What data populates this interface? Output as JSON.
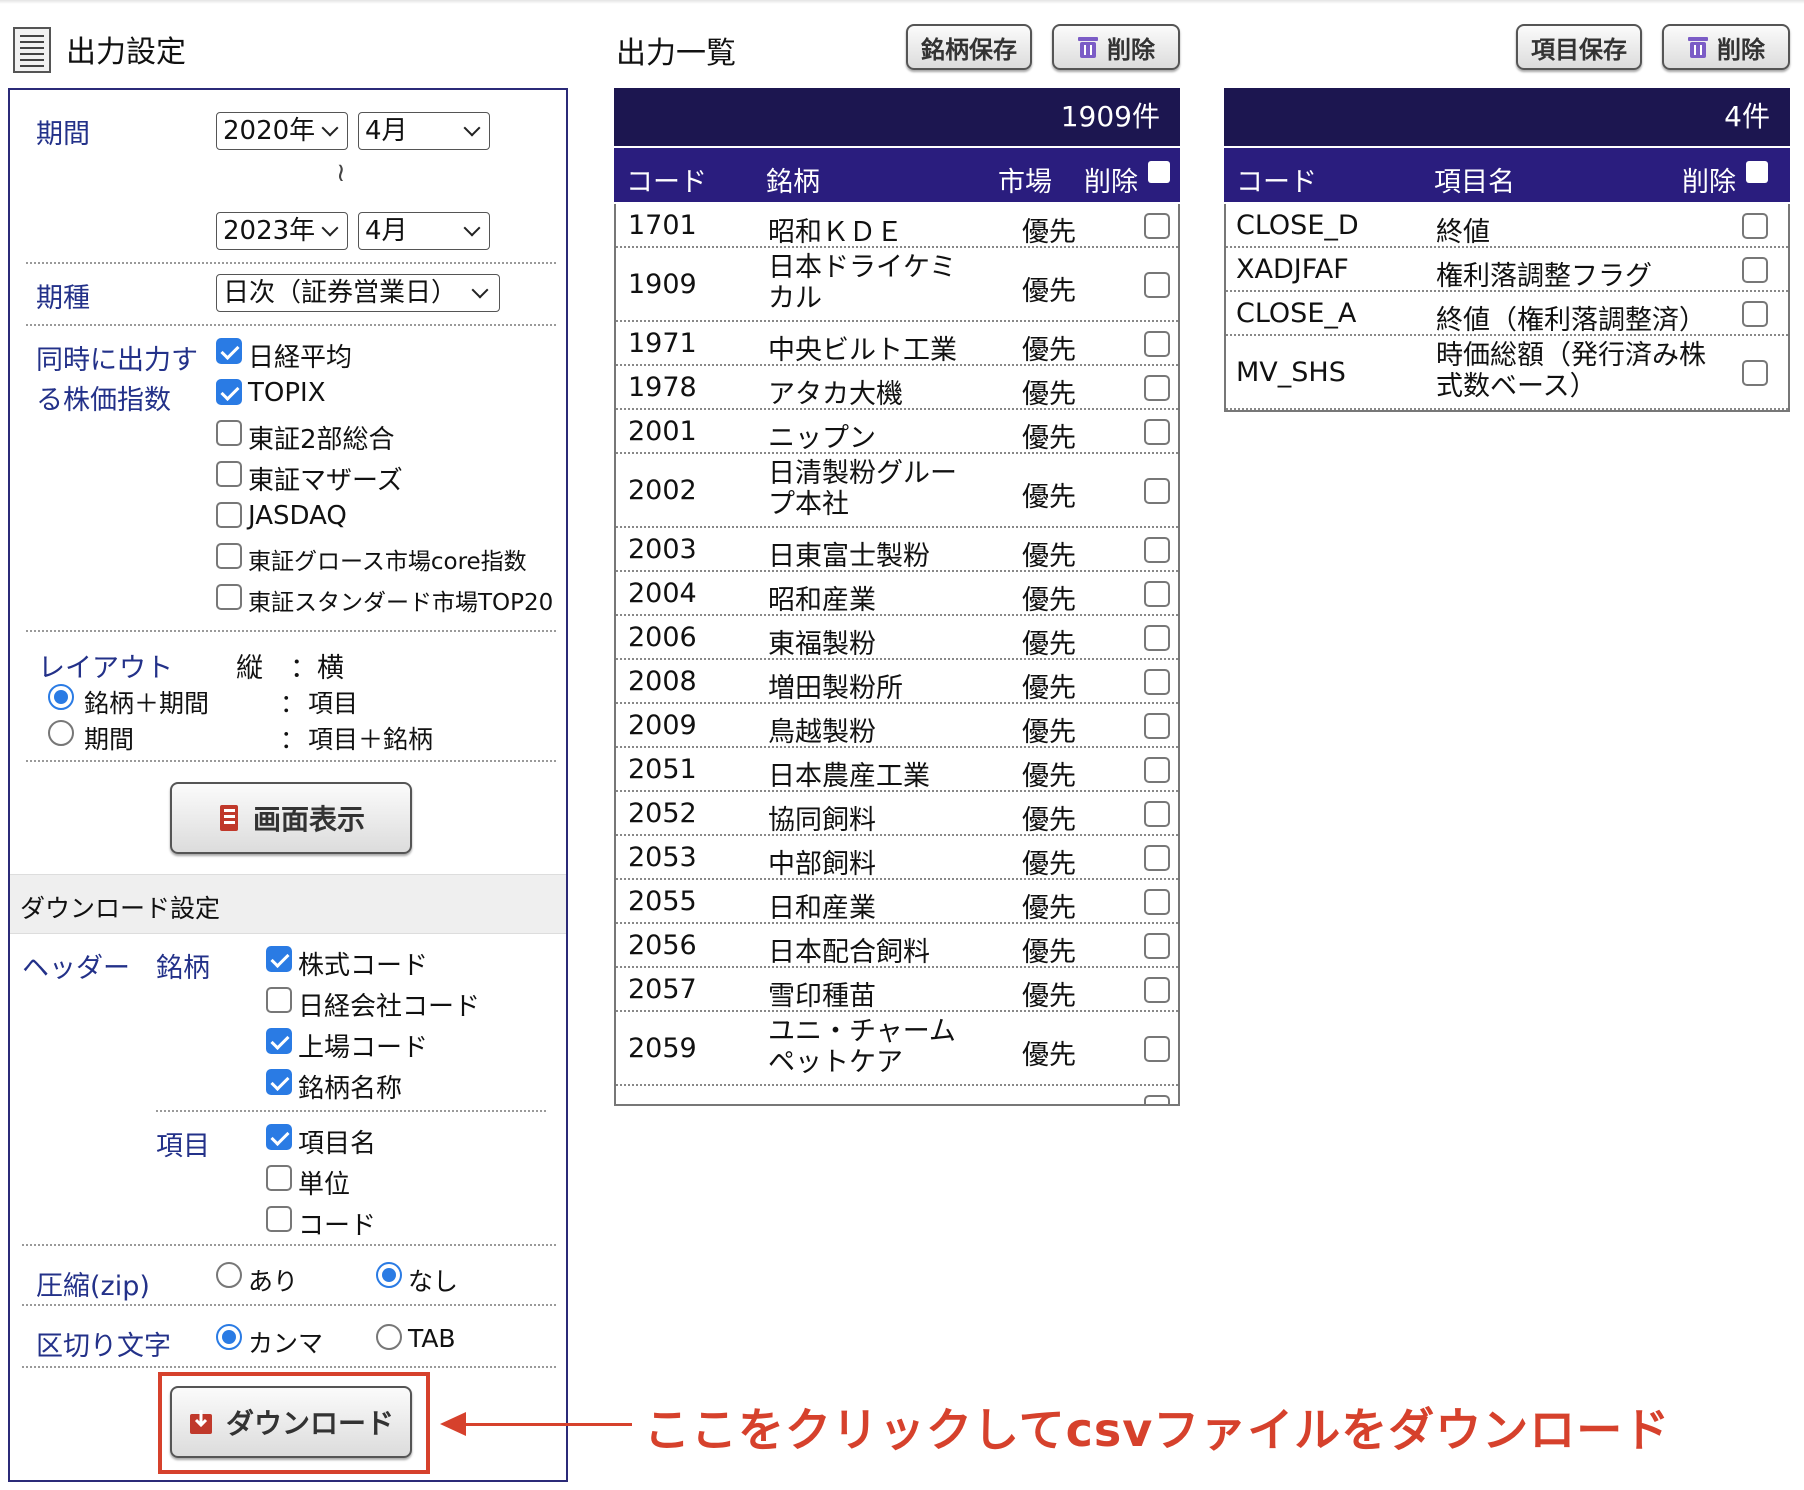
{
  "settings": {
    "title": "出力設定",
    "period_label": "期間",
    "period_from_year": "2020年",
    "period_from_month": "4月",
    "tilde": "≀",
    "period_to_year": "2023年",
    "period_to_month": "4月",
    "kind_label": "期種",
    "kind_value": "日次（証券営業日）",
    "index_label_1": "同時に出力す",
    "index_label_2": "る株価指数",
    "indices": [
      {
        "label": "日経平均",
        "checked": true
      },
      {
        "label": "TOPIX",
        "checked": true
      },
      {
        "label": "東証2部総合",
        "checked": false
      },
      {
        "label": "東証マザーズ",
        "checked": false
      },
      {
        "label": "JASDAQ",
        "checked": false
      },
      {
        "label": "東証グロース市場core指数",
        "checked": false
      },
      {
        "label": "東証スタンダード市場TOP20",
        "checked": false
      }
    ],
    "layout_label": "レイアウト",
    "layout_header": "縦　：横",
    "layout_options": [
      {
        "left": "銘柄＋期間",
        "colon": "：",
        "right": "項目",
        "selected": true
      },
      {
        "left": "期間",
        "colon": "：",
        "right": "項目＋銘柄",
        "selected": false
      }
    ],
    "display_button": "画面表示"
  },
  "download": {
    "section_title": "ダウンロード設定",
    "header_label": "ヘッダー",
    "brand_label": "銘柄",
    "brand_options": [
      {
        "label": "株式コード",
        "checked": true
      },
      {
        "label": "日経会社コード",
        "checked": false
      },
      {
        "label": "上場コード",
        "checked": true
      },
      {
        "label": "銘柄名称",
        "checked": true
      }
    ],
    "item_label": "項目",
    "item_options": [
      {
        "label": "項目名",
        "checked": true
      },
      {
        "label": "単位",
        "checked": false
      },
      {
        "label": "コード",
        "checked": false
      }
    ],
    "zip_label": "圧縮(zip)",
    "zip_yes": "あり",
    "zip_no": "なし",
    "zip_selected": "なし",
    "delim_label": "区切り文字",
    "delim_comma": "カンマ",
    "delim_tab": "TAB",
    "delim_selected": "カンマ",
    "download_button": "ダウンロード"
  },
  "output_list": {
    "title": "出力一覧",
    "save_button": "銘柄保存",
    "delete_button": "削除",
    "count": "1909件",
    "headers": {
      "code": "コード",
      "name": "銘柄",
      "market": "市場",
      "delete": "削除"
    },
    "rows": [
      {
        "code": "1701",
        "name": [
          "昭和ＫＤＥ"
        ],
        "market": "優先"
      },
      {
        "code": "1909",
        "name": [
          "日本ドライケミ",
          "カル"
        ],
        "market": "優先"
      },
      {
        "code": "1971",
        "name": [
          "中央ビルト工業"
        ],
        "market": "優先"
      },
      {
        "code": "1978",
        "name": [
          "アタカ大機"
        ],
        "market": "優先"
      },
      {
        "code": "2001",
        "name": [
          "ニップン"
        ],
        "market": "優先"
      },
      {
        "code": "2002",
        "name": [
          "日清製粉グルー",
          "プ本社"
        ],
        "market": "優先"
      },
      {
        "code": "2003",
        "name": [
          "日東富士製粉"
        ],
        "market": "優先"
      },
      {
        "code": "2004",
        "name": [
          "昭和産業"
        ],
        "market": "優先"
      },
      {
        "code": "2006",
        "name": [
          "東福製粉"
        ],
        "market": "優先"
      },
      {
        "code": "2008",
        "name": [
          "増田製粉所"
        ],
        "market": "優先"
      },
      {
        "code": "2009",
        "name": [
          "鳥越製粉"
        ],
        "market": "優先"
      },
      {
        "code": "2051",
        "name": [
          "日本農産工業"
        ],
        "market": "優先"
      },
      {
        "code": "2052",
        "name": [
          "協同飼料"
        ],
        "market": "優先"
      },
      {
        "code": "2053",
        "name": [
          "中部飼料"
        ],
        "market": "優先"
      },
      {
        "code": "2055",
        "name": [
          "日和産業"
        ],
        "market": "優先"
      },
      {
        "code": "2056",
        "name": [
          "日本配合飼料"
        ],
        "market": "優先"
      },
      {
        "code": "2057",
        "name": [
          "雪印種苗"
        ],
        "market": "優先"
      },
      {
        "code": "2059",
        "name": [
          "ユニ・チャーム",
          "ペットケア"
        ],
        "market": "優先"
      }
    ]
  },
  "item_list": {
    "save_button": "項目保存",
    "delete_button": "削除",
    "count": "4件",
    "headers": {
      "code": "コード",
      "name": "項目名",
      "delete": "削除"
    },
    "rows": [
      {
        "code": "CLOSE_D",
        "name": [
          "終値"
        ]
      },
      {
        "code": "XADJFAF",
        "name": [
          "権利落調整フラグ"
        ]
      },
      {
        "code": "CLOSE_A",
        "name": [
          "終値（権利落調整済）"
        ]
      },
      {
        "code": "MV_SHS",
        "name": [
          "時価総額（発行済み株",
          "式数ベース）"
        ]
      }
    ]
  },
  "annotation": "ここをクリックしてcsvファイルをダウンロード",
  "colors": {
    "label": "#233189",
    "table_count_bg": "#1c1650",
    "table_head_bg": "#2a1d7e",
    "accent": "#2a7be4",
    "annotation": "#d6412c"
  },
  "icons": {
    "title": "document-icon",
    "delete": "trash-icon",
    "display": "book-icon",
    "download": "download-icon"
  }
}
